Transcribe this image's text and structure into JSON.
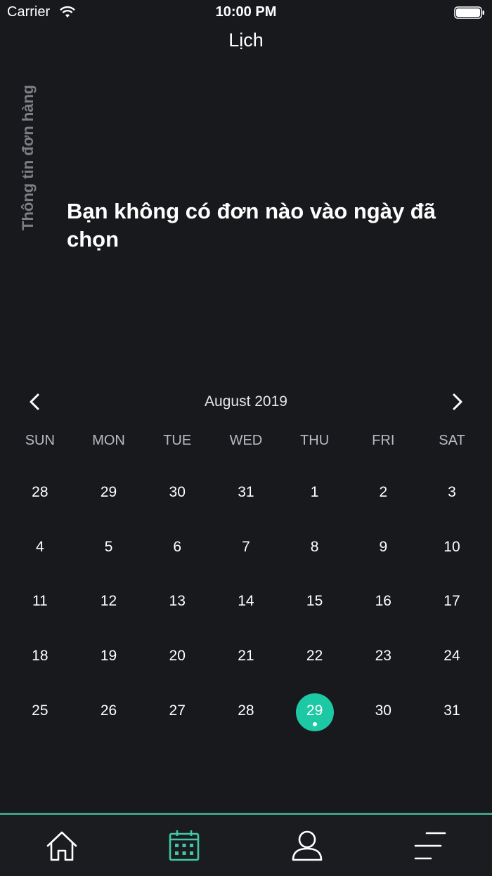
{
  "status_bar": {
    "carrier": "Carrier",
    "time": "10:00 PM",
    "icons": [
      "wifi-icon",
      "battery-icon"
    ]
  },
  "nav": {
    "title": "Lịch"
  },
  "side_panel": {
    "label": "Thông tin đơn hàng"
  },
  "empty_state": {
    "message": "Bạn không có đơn nào vào ngày đã chọn"
  },
  "calendar": {
    "month_label": "August 2019",
    "prev_icon": "chevron-left-icon",
    "next_icon": "chevron-right-icon",
    "weekdays": [
      "SUN",
      "MON",
      "TUE",
      "WED",
      "THU",
      "FRI",
      "SAT"
    ],
    "weeks": [
      [
        "28",
        "29",
        "30",
        "31",
        "1",
        "2",
        "3"
      ],
      [
        "4",
        "5",
        "6",
        "7",
        "8",
        "9",
        "10"
      ],
      [
        "11",
        "12",
        "13",
        "14",
        "15",
        "16",
        "17"
      ],
      [
        "18",
        "19",
        "20",
        "21",
        "22",
        "23",
        "24"
      ],
      [
        "25",
        "26",
        "27",
        "28",
        "29",
        "30",
        "31"
      ]
    ],
    "selected_day": "29",
    "accent_color": "#1dc9a4"
  },
  "tabbar": {
    "tabs": [
      {
        "icon": "home-icon",
        "active": false
      },
      {
        "icon": "calendar-icon",
        "active": true
      },
      {
        "icon": "profile-icon",
        "active": false
      },
      {
        "icon": "menu-icon",
        "active": false
      }
    ],
    "active_color": "#3fc9a6",
    "border_color": "#3e9f86"
  }
}
